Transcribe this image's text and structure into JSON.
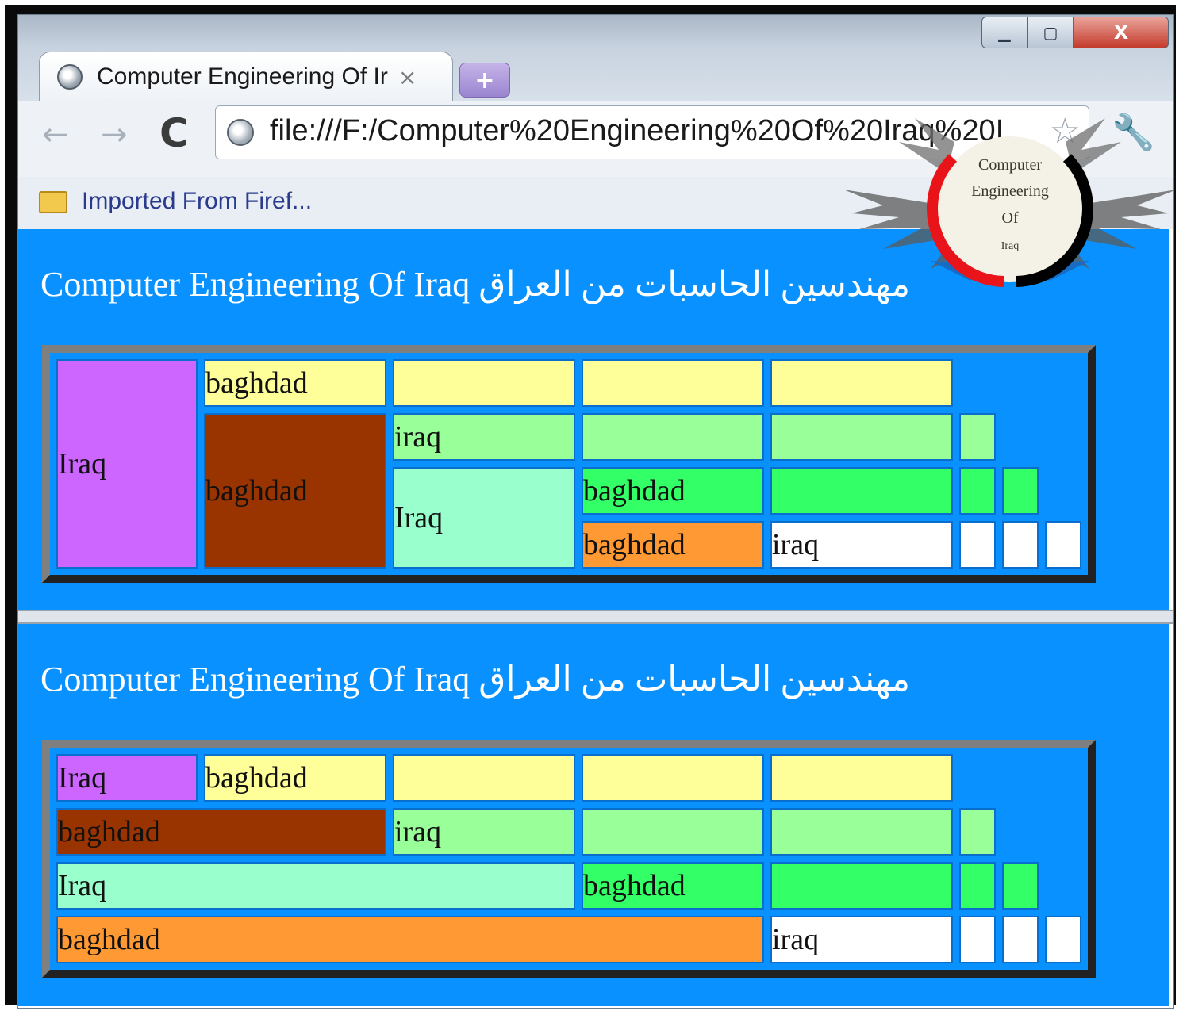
{
  "window": {
    "controls": {
      "minimize": "▁",
      "maximize": "▢",
      "close": "X"
    }
  },
  "tab": {
    "title": "Computer Engineering Of Ir",
    "close": "×",
    "new_tab": "+"
  },
  "toolbar": {
    "back": "←",
    "forward": "→",
    "reload": "C",
    "url": "file:///F:/Computer%20Engineering%20Of%20Iraq%20I",
    "star": "☆",
    "wrench": "🔧"
  },
  "bookmarks": {
    "items": [
      {
        "label": "Imported From Firef..."
      }
    ]
  },
  "logo": {
    "line1": "Computer",
    "line2": "Engineering",
    "line3": "Of",
    "line4": "Iraq"
  },
  "frames": [
    {
      "heading": "Computer Engineering Of Iraq مهندسين الحاسبات من العراق",
      "cells": {
        "iraq_tall": "Iraq",
        "r1_baghdad": "baghdad",
        "baghdad_tall": "baghdad",
        "r2_iraq": "iraq",
        "iraq_mid": "Iraq",
        "r3_baghdad": "baghdad",
        "r4_baghdad": "baghdad",
        "r4_iraq": "iraq"
      }
    },
    {
      "heading": "Computer Engineering Of Iraq مهندسين الحاسبات من العراق",
      "cells": {
        "r1_iraq": "Iraq",
        "r1_baghdad": "baghdad",
        "r2_baghdad": "baghdad",
        "r2_iraq": "iraq",
        "r3_iraq": "Iraq",
        "r3_baghdad": "baghdad",
        "r4_baghdad": "baghdad",
        "r4_iraq": "iraq"
      }
    }
  ],
  "colors": {
    "pane_bg": "#0992ff",
    "purple": "#cc66ff",
    "yellow": "#ffff99",
    "brown": "#993300",
    "light_green": "#99ff99",
    "aqua": "#99ffcc",
    "green": "#33ff66",
    "orange": "#ff9933",
    "white": "#ffffff"
  }
}
